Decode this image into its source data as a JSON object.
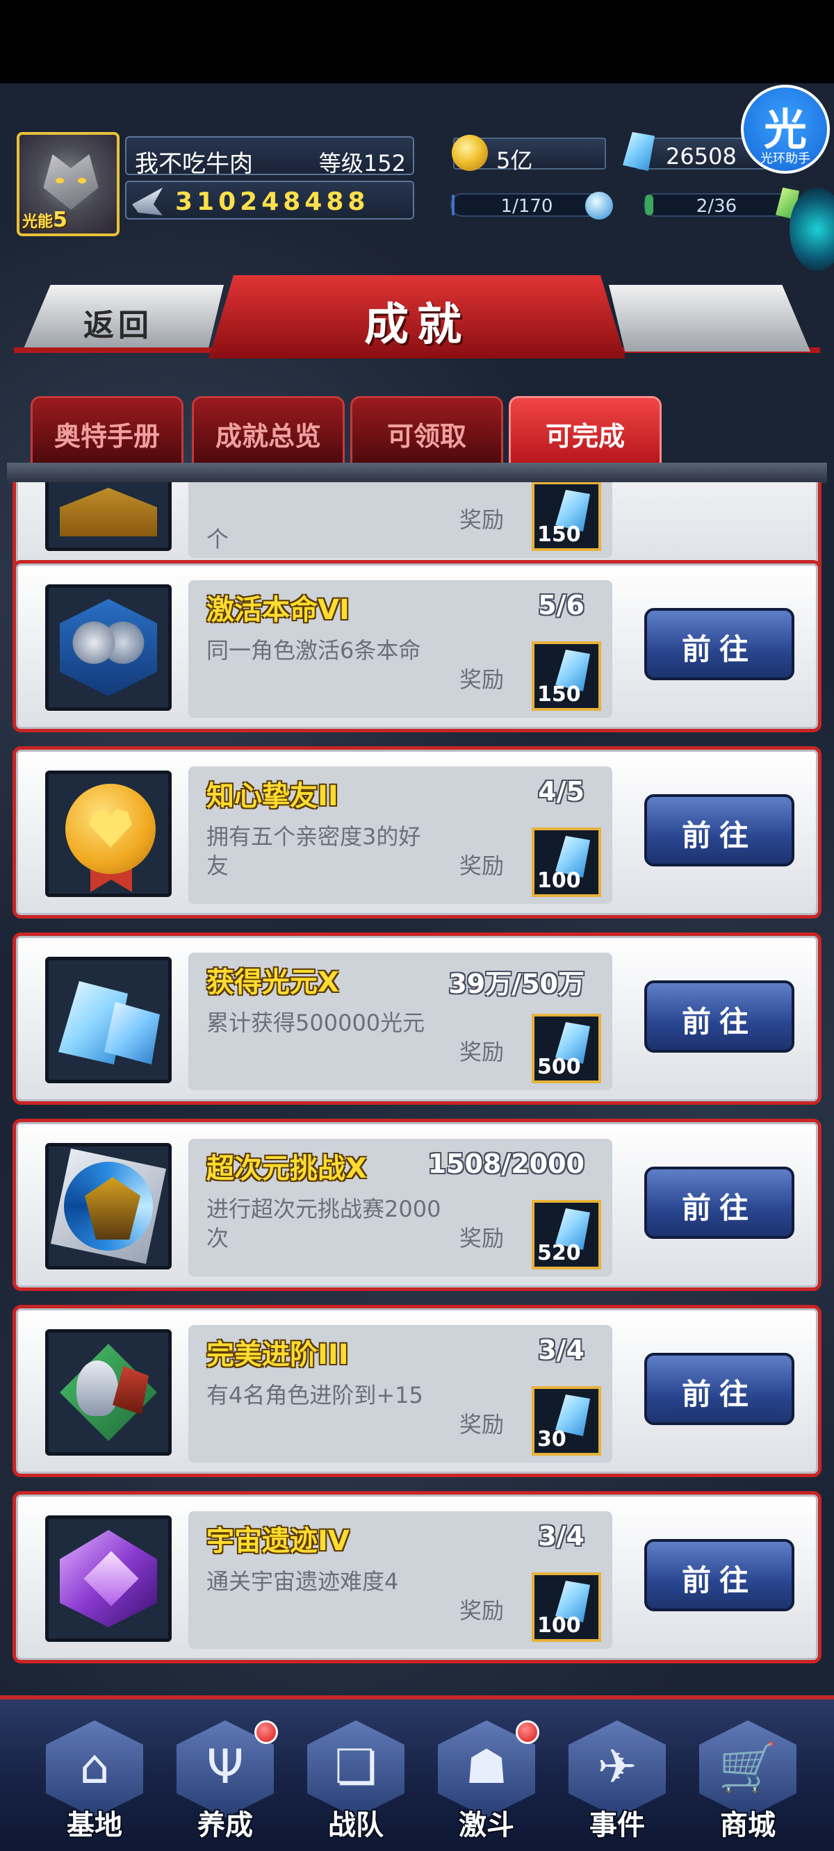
{
  "profile": {
    "name": "我不吃牛肉",
    "level": "等级152",
    "light_energy_label": "光能",
    "light_energy_value": "5",
    "power": "310248488"
  },
  "resources": {
    "gold": "5亿",
    "crystals": "26508",
    "stamina": "1/170",
    "stamina_fraction": 0.006,
    "energy": "2/36",
    "energy_fraction": 0.056
  },
  "helper": {
    "big": "光",
    "small": "光环助手"
  },
  "header": {
    "back_label": "返回",
    "title": "成就"
  },
  "tabs": [
    {
      "label": "奥特手册",
      "active": false
    },
    {
      "label": "成就总览",
      "active": false
    },
    {
      "label": "可领取",
      "active": false
    },
    {
      "label": "可完成",
      "active": true
    }
  ],
  "partial_card": {
    "desc_tail": "个",
    "reward_label": "奖励",
    "reward_amount": "150"
  },
  "achievements": [
    {
      "icon": "ultraman-pair-icon",
      "title": "激活本命VI",
      "progress": "5/6",
      "desc": "同一角色激活6条本命",
      "reward_label": "奖励",
      "reward_amount": "150",
      "button": "前往"
    },
    {
      "icon": "heart-medal-icon",
      "title": "知心挚友II",
      "progress": "4/5",
      "desc": "拥有五个亲密度3的好友",
      "reward_label": "奖励",
      "reward_amount": "100",
      "button": "前往"
    },
    {
      "icon": "crystal-pile-icon",
      "title": "获得光元X",
      "progress": "39万/50万",
      "desc": "累计获得500000光元",
      "reward_label": "奖励",
      "reward_amount": "500",
      "button": "前往"
    },
    {
      "icon": "monster-vortex-icon",
      "title": "超次元挑战X",
      "progress": "1508/2000",
      "desc": "进行超次元挑战赛2000次",
      "reward_label": "奖励",
      "reward_amount": "520",
      "button": "前往"
    },
    {
      "icon": "ultraman-advance-icon",
      "title": "完美进阶III",
      "progress": "3/4",
      "desc": "有4名角色进阶到+15",
      "reward_label": "奖励",
      "reward_amount": "30",
      "button": "前往"
    },
    {
      "icon": "cosmic-ruins-icon",
      "title": "宇宙遗迹IV",
      "progress": "3/4",
      "desc": "通关宇宙遗迹难度4",
      "reward_label": "奖励",
      "reward_amount": "100",
      "button": "前往"
    }
  ],
  "nav": [
    {
      "label": "基地",
      "icon": "base-icon",
      "glyph": "⌂",
      "badge": false
    },
    {
      "label": "养成",
      "icon": "training-icon",
      "glyph": "Ψ",
      "badge": true
    },
    {
      "label": "战队",
      "icon": "team-cards-icon",
      "glyph": "❏",
      "badge": false
    },
    {
      "label": "激斗",
      "icon": "battle-icon",
      "glyph": "☗",
      "badge": true
    },
    {
      "label": "事件",
      "icon": "event-jet-icon",
      "glyph": "✈",
      "badge": false
    },
    {
      "label": "商城",
      "icon": "shop-cart-icon",
      "glyph": "🛒",
      "badge": false
    }
  ]
}
